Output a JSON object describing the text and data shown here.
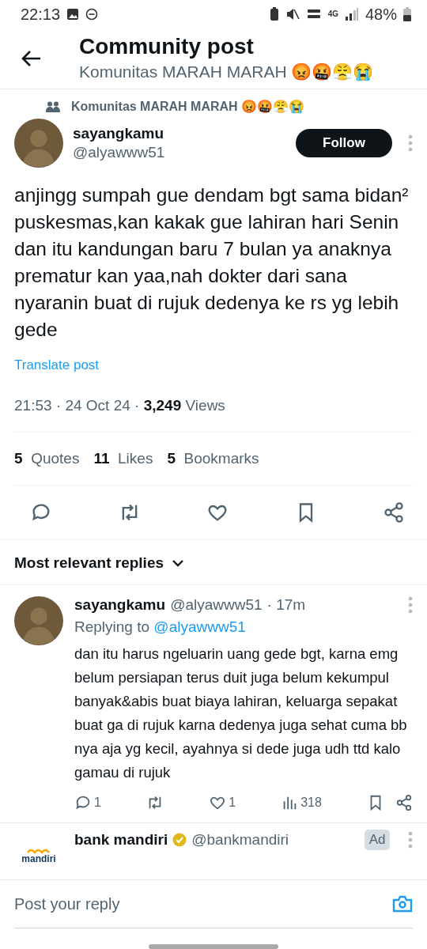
{
  "status_bar": {
    "time": "22:13",
    "network": "4G",
    "battery": "48%"
  },
  "header": {
    "title": "Community post",
    "subtitle": "Komunitas MARAH MARAH 😡🤬😤😭"
  },
  "post": {
    "community": "Komunitas MARAH MARAH 😡🤬😤😭",
    "author": {
      "name": "sayangkamu",
      "handle": "@alyawww51"
    },
    "follow_label": "Follow",
    "text": "anjingg sumpah gue dendam bgt sama bidan² puskesmas,kan kakak gue lahiran hari Senin dan itu kandungan baru 7 bulan ya anaknya prematur kan yaa,nah dokter dari sana nyaranin buat di rujuk dedenya ke rs yg lebih gede",
    "translate": "Translate post",
    "meta": "21:53 · 24 Oct 24 · **3,249** Views",
    "stats": [
      {
        "count": "5",
        "label": "Quotes"
      },
      {
        "count": "11",
        "label": "Likes"
      },
      {
        "count": "5",
        "label": "Bookmarks"
      }
    ]
  },
  "sort": {
    "label": "Most relevant replies"
  },
  "replies": [
    {
      "kind": "reply",
      "name": "sayangkamu",
      "handle": "@alyawww51",
      "time": "· 17m",
      "replying_to": "Replying to",
      "replying_handle": "@alyawww51",
      "text": "dan itu harus ngeluarin uang gede bgt, karna emg belum persiapan terus duit juga belum kekumpul banyak&abis buat biaya lahiran, keluarga sepakat buat ga di rujuk karna dedenya juga sehat cuma bb nya aja yg kecil, ayahnya si dede juga udh ttd kalo gamau di rujuk",
      "reply_count": "1",
      "like_count": "1",
      "views": "318"
    },
    {
      "kind": "ad",
      "name": "bank mandiri",
      "handle": "@bankmandiri",
      "logo": "mandiri",
      "badge": "Ad"
    }
  ],
  "composer": {
    "placeholder": "Post your reply"
  }
}
